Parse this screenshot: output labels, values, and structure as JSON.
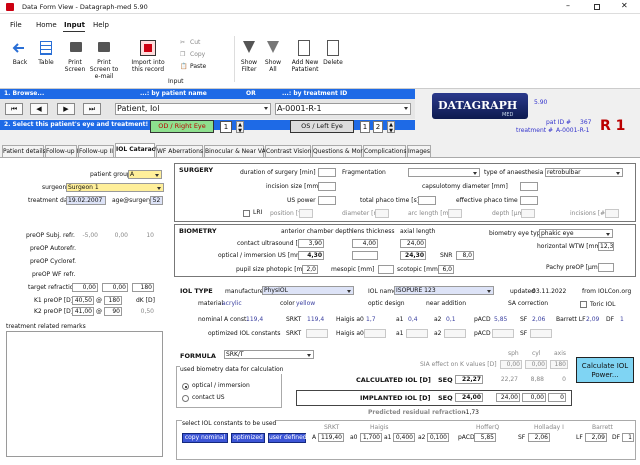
{
  "window": {
    "title": "Data Form View - Datagraph-med 5.90"
  },
  "menu": [
    "File",
    "Home",
    "Input",
    "Help"
  ],
  "ribbon": {
    "buttons": [
      "Back",
      "Table",
      "Print Screen",
      "Print Screen to e-mail",
      "Import into this record",
      "Cut",
      "Copy",
      "Paste",
      "Show Filter",
      "Show All",
      "Add New Patatient",
      "Delete"
    ],
    "group_label": "Input"
  },
  "topbar": {
    "browse": "1. Browse...",
    "by_name": "...: by patient name",
    "or": "OR",
    "by_id": "...: by treatment ID",
    "patient_name": "Patient, Iol",
    "patient_id": "A-0001-R-1",
    "version": "5.90",
    "logo": "DATAGRAPH",
    "logo_sub": "MED",
    "select_eye": "2. Select this patient's eye and treatment!",
    "od": "OD / Right Eye",
    "od_num": "1",
    "os": "OS / Left Eye",
    "os_nums": [
      "1",
      "2"
    ],
    "pat_id_label": "pat ID #",
    "pat_id": "367",
    "treatment_label": "treatment #",
    "treatment": "A-0001-R-1",
    "eye_code": "R 1"
  },
  "tabs": [
    "Patient details",
    "Follow-up I",
    "Follow-up II",
    "IOL Cataract",
    "WF Aberrations",
    "Binocular & Near VA",
    "Contrast Vision",
    "Questions & More",
    "Complications",
    "Images"
  ],
  "left": {
    "patient_group_label": "patient group",
    "patient_group": "A",
    "surgeon_label": "surgeon",
    "surgeon": "Surgeon 1",
    "treatment_date_label": "treatment date",
    "treatment_date": "19.02.2007",
    "age_label": "age@surgery",
    "age": "52",
    "rows": [
      {
        "label": "preOP Subj. refr.",
        "v": [
          "-5,00",
          "0,00",
          "10"
        ]
      },
      {
        "label": "preOP Autorefr.",
        "v": [
          "",
          "",
          ""
        ]
      },
      {
        "label": "preOP Cycloref.",
        "v": [
          "",
          "",
          ""
        ]
      },
      {
        "label": "preOP WF refr.",
        "v": [
          "",
          "",
          ""
        ]
      },
      {
        "label": "target refraction",
        "v": [
          "0,00",
          "0,00",
          "180"
        ]
      }
    ],
    "k1_label": "K1 preOP [D]",
    "k1": "40,50",
    "k1_at": "@",
    "k1_axis": "180",
    "dk_label": "dK [D]",
    "k2_label": "K2 preOP [D]",
    "k2": "41,00",
    "k2_at": "@",
    "k2_axis": "90",
    "dk": "0,50",
    "remarks_label": "treatment related remarks"
  },
  "surgery": {
    "title": "SURGERY",
    "duration_label": "duration of surgery [min]",
    "fragmentation_label": "Fragmentation",
    "anaesthesia_label": "type of anaesthesia",
    "anaesthesia": "retrobulbar",
    "incision_label": "incision size [mm]",
    "capsulo_label": "capsulotomy diameter [mm]",
    "us_power_label": "US power",
    "phaco_label": "total phaco time [s]",
    "eff_phaco_label": "effective phaco time [s]",
    "lri_label": "LRI",
    "lri_cols": [
      "position [°]",
      "diameter [mm]",
      "arc length [mm]",
      "depth [µm]",
      "incisions [#]"
    ]
  },
  "biometry": {
    "title": "BIOMETRY",
    "acd_header": "anterior chamber depth",
    "lens_header": "lens thickness",
    "axial_header": "axial length",
    "eye_type_label": "biometry eye type",
    "eye_type": "phakic eye",
    "contact_us_label": "contact ultrasound [mm]",
    "contact_acd": "3,90",
    "contact_lens": "4,00",
    "contact_axial": "24,00",
    "wtw_label": "horizontal WTW [mm]",
    "wtw": "12,3",
    "optical_label": "optical / immersion US [mm]",
    "optical_acd": "4,30",
    "optical_axial": "24,30",
    "snr_label": "SNR",
    "snr": "8,0",
    "pupil_label": "pupil size photopic [mm]",
    "pupil": "2,0",
    "mesopic_label": "mesopic [mm]",
    "scotopic_label": "scotopic [mm]",
    "scotopic": "6,0",
    "pachy_label": "Pachy preOP [µm]"
  },
  "iol": {
    "title": "IOL TYPE",
    "manufacturer_label": "manufacturer",
    "manufacturer": "PhysIOL",
    "name_label": "IOL name",
    "name": "ISOPURE 123",
    "updated_label": "updated",
    "updated": "03.11.2022",
    "from_label": "from",
    "from": "IOLCon.org",
    "material_label": "material",
    "material": "acrylic",
    "color_label": "color",
    "color": "yellow",
    "optic_label": "optic design",
    "near_label": "near addition",
    "sa_label": "SA correction",
    "toric_label": "Toric IOL",
    "nominal_label": "nominal A const.",
    "nominal_a": "119,4",
    "srkt_label": "SRKT",
    "srkt": "119,4",
    "haigis_label": "Haigis a0",
    "haigis_a0": "1,7",
    "a1_label": "a1",
    "a1": "0,4",
    "a2_label": "a2",
    "a2": "0,1",
    "pacd_label": "pACD",
    "pacd": "5,85",
    "sf_label": "SF",
    "sf": "2,06",
    "barrett_label": "Barrett LF",
    "barrett": "2,09",
    "df_label": "DF",
    "df": "1",
    "optimized_label": "optimized IOL constants",
    "opt_srkt_label": "SRKT",
    "opt_haigis_label": "Haigis a0",
    "opt_a1_label": "a1",
    "opt_a2_label": "a2",
    "opt_pacd_label": "pACD",
    "opt_sf_label": "SF"
  },
  "formula": {
    "label": "FORMULA",
    "value": "SRK/T",
    "sia_label": "SIA effect on K values [D]",
    "sph_label": "sph",
    "cyl_label": "cyl",
    "axis_label": "axis",
    "sia": [
      "0,00",
      "0,00",
      "180"
    ],
    "calc_btn": "Calculate IOL Power...",
    "biom_group": "used biometry data for calculation",
    "opt1": "optical / immersion",
    "opt2": "contact US",
    "calc_label": "CALCULATED IOL [D]",
    "seq_label": "SEQ",
    "calc_iol": "22,27",
    "calc_r1": "22,27",
    "calc_r2": "8,88",
    "calc_r3": "0",
    "impl_label": "IMPLANTED IOL [D]",
    "impl_seq_label": "SEQ",
    "impl_iol": "24,00",
    "impl_r1": "24,00",
    "impl_r2": "0,00",
    "impl_r3": "0",
    "resid_label": "Predicted residual refraction",
    "resid": "-1,73"
  },
  "constants": {
    "title": "select IOL constants to be used",
    "btn1": "copy nominal",
    "btn2": "optimized",
    "btn3": "user defined",
    "head_srkt": "SRKT",
    "head_haigis": "Haigis",
    "head_hoffer": "HofferQ",
    "head_holladay": "Holladay I",
    "head_barrett": "Barrett",
    "a_label": "A",
    "a": "119,40",
    "a0_label": "a0",
    "a0": "1,700",
    "a1_label": "a1",
    "a1": "0,400",
    "a2_label": "a2",
    "a2": "0,100",
    "pacd_label": "pACD",
    "pacd": "5,85",
    "sf_label": "SF",
    "sf": "2,06",
    "lf_label": "LF",
    "lf": "2,09",
    "df_label": "DF",
    "df": "1"
  }
}
